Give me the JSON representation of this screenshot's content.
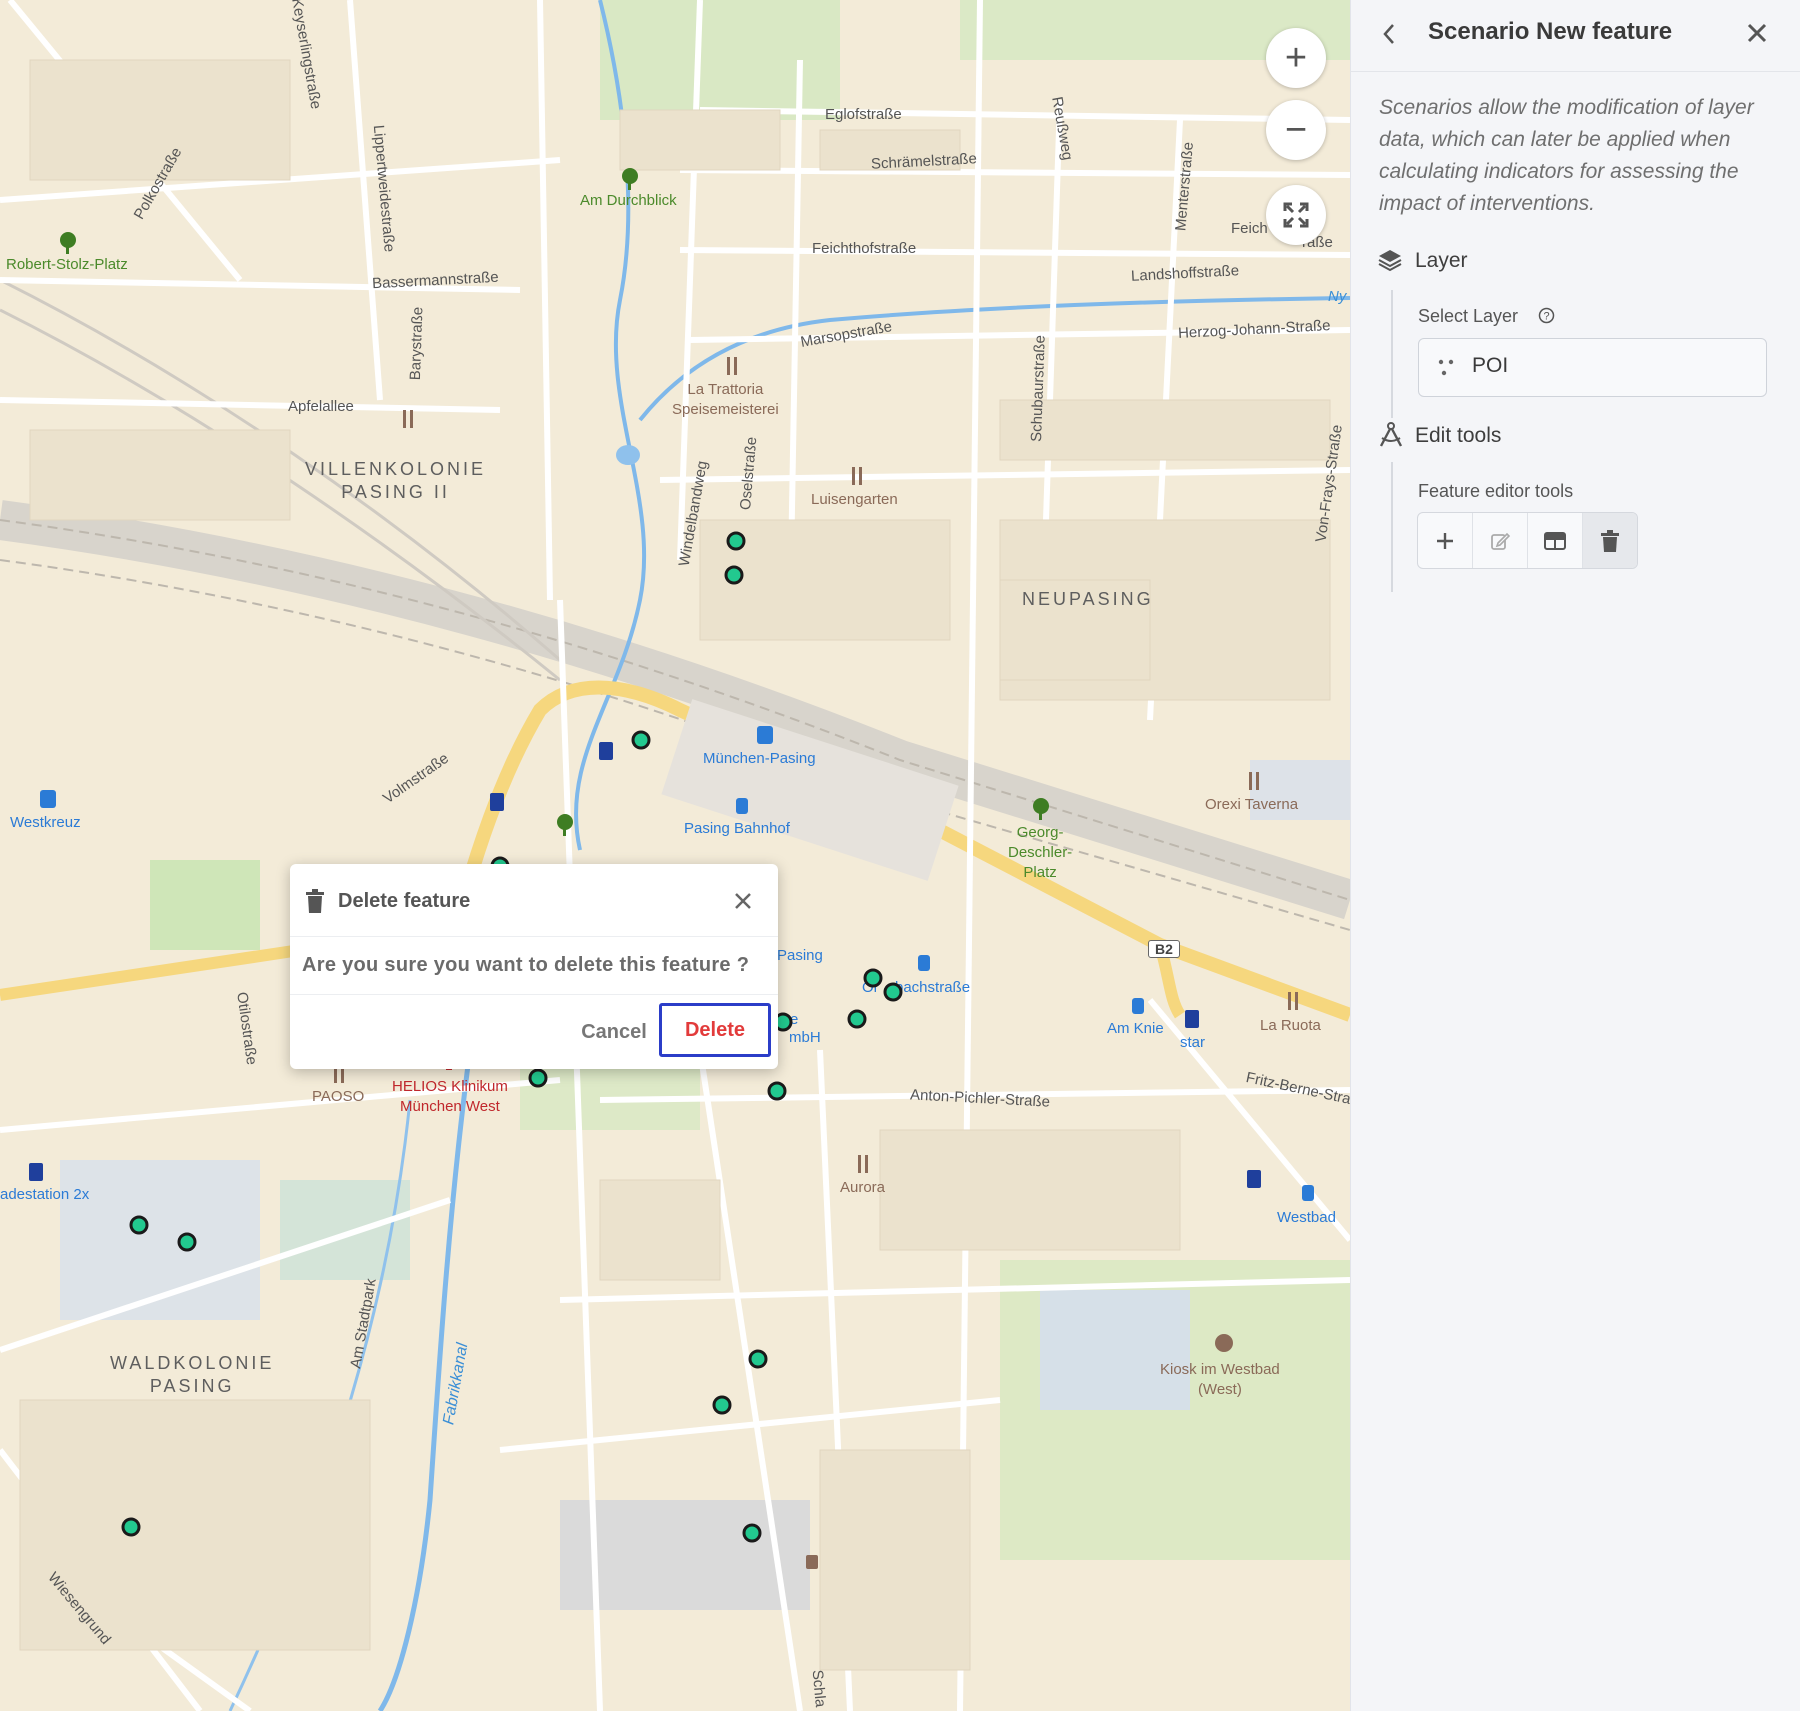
{
  "map": {
    "streets": [
      "Eglofstraße",
      "Schrämelstraße",
      "Reußweg",
      "Feichthofstraße",
      "Menterstraße",
      "Landshoffstraße",
      "Herzog-Johann-Straße",
      "Marsopstraße",
      "Keyserlingstraße",
      "Polkostraße",
      "Lippertweidestraße",
      "Bassermannstraße",
      "Barystraße",
      "Apfelallee",
      "Oselstraße",
      "Windelbandweg",
      "Schubaurstraße",
      "Von-Frays-Straße",
      "Volmstraße",
      "Otilostraße",
      "Anton-Pichler-Straße",
      "Fritz-Berne-Stra",
      "Am Stadtpark",
      "Fabrikkanal",
      "Wiesengrund",
      "Schla",
      "Feich",
      "raße",
      "Ny",
      "bachstraße"
    ],
    "places": {
      "robert_stolz": "Robert-Stolz-Platz",
      "am_durchblick": "Am Durchblick",
      "la_trattoria": "La Trattoria\nSpeisemeisterei",
      "luisengarten": "Luisengarten",
      "villenkolonie": "VILLENKOLONIE\nPASING II",
      "neupasing": "NEUPASING",
      "muenchen_pasing": "München-Pasing",
      "pasing_bahnhof": "Pasing Bahnhof",
      "westkreuz": "Westkreuz",
      "georg_deschler": "Georg-\nDeschler-\nPlatz",
      "orexi": "Orexi Taverna",
      "pasing_partial": "Pasing",
      "am_knie": "Am Knie",
      "star": "star",
      "la_ruota": "La Ruota",
      "b2": "B2",
      "helios": "HELIOS Klinikum\nMünchen West",
      "paoso": "PAOSO",
      "aurora": "Aurora",
      "westbad": "Westbad",
      "ladestation": "adestation 2x",
      "waldkolonie": "WALDKOLONIE\nPASING",
      "kiosk": "Kiosk im Westbad\n(West)",
      "gmbh": "mbH",
      "e_partial": "e",
      "or_partial": "Or"
    },
    "controls": {
      "zoom_in": "+",
      "zoom_out": "−"
    }
  },
  "panel": {
    "title": "Scenario New feature",
    "description": "Scenarios allow the modification of layer data, which can later be applied when calculating indicators for assessing the impact of interventions.",
    "layer_section": "Layer",
    "select_layer_label": "Select Layer",
    "selected_layer": "POI",
    "edit_tools_section": "Edit tools",
    "feature_editor_label": "Feature editor tools"
  },
  "dialog": {
    "title": "Delete feature",
    "message": "Are you sure you want to delete this feature ?",
    "cancel": "Cancel",
    "delete": "Delete"
  }
}
